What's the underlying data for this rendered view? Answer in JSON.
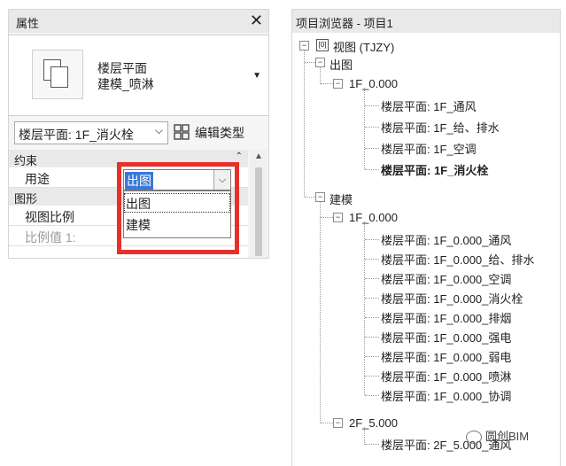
{
  "properties": {
    "title": "属性",
    "close_icon": "close-icon",
    "type_selector": {
      "line1": "楼层平面",
      "line2": "建模_喷淋"
    },
    "filter_value": "楼层平面: 1F_消火栓",
    "edit_type_label": "编辑类型",
    "categories": {
      "constraints": "约束",
      "graphics": "图形"
    },
    "rows": {
      "usage": "用途",
      "view_scale": "视图比例",
      "scale_value_partial": "比例值 1:"
    },
    "dropdown": {
      "value": "出图",
      "options": [
        "出图",
        "建模"
      ]
    }
  },
  "browser": {
    "title": "项目浏览器 - 项目1",
    "root": "视图 (TJZY)",
    "groups": [
      {
        "label": "出图",
        "levels": [
          {
            "label": "1F_0.000",
            "views": [
              "楼层平面: 1F_通风",
              "楼层平面: 1F_给、排水",
              "楼层平面: 1F_空调",
              "楼层平面: 1F_消火栓"
            ]
          }
        ]
      },
      {
        "label": "建模",
        "levels": [
          {
            "label": "1F_0.000",
            "views": [
              "楼层平面: 1F_0.000_通风",
              "楼层平面: 1F_0.000_给、排水",
              "楼层平面: 1F_0.000_空调",
              "楼层平面: 1F_0.000_消火栓",
              "楼层平面: 1F_0.000_排烟",
              "楼层平面: 1F_0.000_强电",
              "楼层平面: 1F_0.000_弱电",
              "楼层平面: 1F_0.000_喷淋",
              "楼层平面: 1F_0.000_协调"
            ]
          },
          {
            "label": "2F_5.000",
            "views": [
              "楼层平面: 2F_5.000_通风"
            ]
          }
        ]
      }
    ]
  },
  "watermark": "圆创BIM",
  "colors": {
    "highlight_border": "#e8302a",
    "selection": "#3b79d6"
  }
}
